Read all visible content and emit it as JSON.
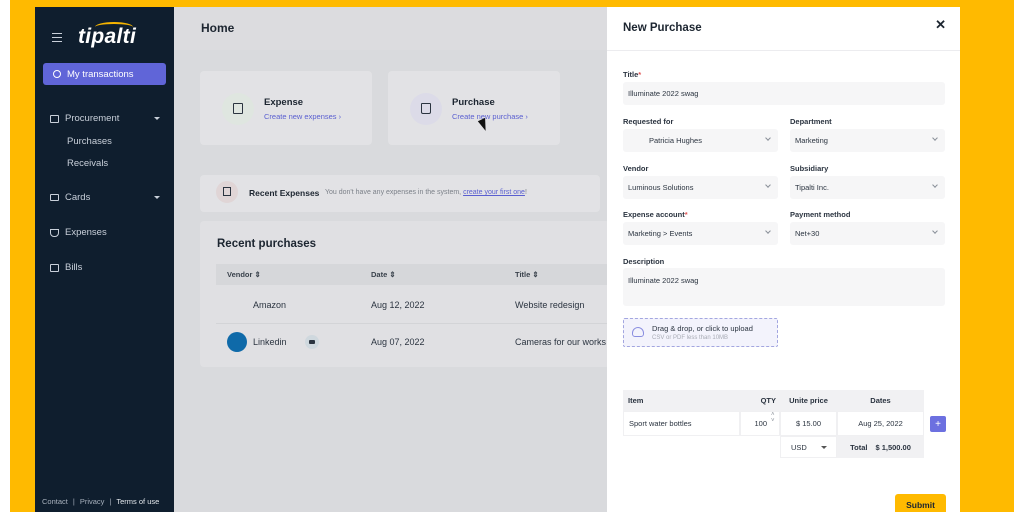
{
  "sidebar": {
    "logo": "tipalti",
    "my_transactions": "My transactions",
    "items": [
      {
        "label": "Procurement",
        "icon": "bag-icon",
        "expanded": true,
        "children": [
          "Purchases",
          "Receivals"
        ]
      },
      {
        "label": "Cards",
        "icon": "card-icon",
        "expanded": false
      },
      {
        "label": "Expenses",
        "icon": "coffee-icon"
      },
      {
        "label": "Bills",
        "icon": "bill-icon"
      }
    ],
    "footer": {
      "contact": "Contact",
      "sep": "|",
      "privacy": "Privacy",
      "terms": "Terms of use"
    }
  },
  "main": {
    "title": "Home",
    "cards": [
      {
        "title": "Expense",
        "link": "Create new expenses ›",
        "color": "#dfe6e0"
      },
      {
        "title": "Purchase",
        "link": "Create new purchase ›",
        "color": "#dcdbe8"
      }
    ],
    "recent_expenses": {
      "title": "Recent Expenses",
      "message": "You don't have any expenses in the system, ",
      "link": "create your first one",
      "suffix": "!"
    },
    "recent_purchases": {
      "title": "Recent purchases",
      "columns": [
        "Vendor ⇕",
        "Date ⇕",
        "Title ⇕"
      ],
      "rows": [
        {
          "vendor": "Amazon",
          "date": "Aug 12, 2022",
          "title": "Website redesign"
        },
        {
          "vendor": "Linkedin",
          "date": "Aug 07, 2022",
          "title": "Cameras for our works"
        }
      ]
    }
  },
  "panel": {
    "title": "New Purchase",
    "close": "✕",
    "fields": {
      "title_label": "Title",
      "title_value": "Illuminate 2022 swag",
      "requested_for_label": "Requested for",
      "requested_for_value": "Patricia Hughes",
      "department_label": "Department",
      "department_value": "Marketing",
      "vendor_label": "Vendor",
      "vendor_value": "Luminous Solutions",
      "subsidiary_label": "Subsidiary",
      "subsidiary_value": "Tipalti Inc.",
      "expense_account_label": "Expense account",
      "expense_account_value": "Marketing > Events",
      "payment_method_label": "Payment method",
      "payment_method_value": "Net+30",
      "description_label": "Description",
      "description_value": "Illuminate 2022 swag",
      "required_mark": "*"
    },
    "upload": {
      "title": "Drag & drop, or click to upload",
      "hint": "CSV or PDF less than 10MB"
    },
    "items_table": {
      "headers": {
        "item": "Item",
        "qty": "QTY",
        "unit_price": "Unite price",
        "dates": "Dates"
      },
      "row": {
        "item": "Sport water bottles",
        "qty": "100",
        "unit_price": "$ 15.00",
        "date": "Aug 25, 2022"
      },
      "currency": "USD",
      "total_label": "Total",
      "total_value": "$ 1,500.00",
      "spin_up": "˄",
      "spin_down": "˅"
    },
    "add_button": "+",
    "submit": "Submit"
  }
}
